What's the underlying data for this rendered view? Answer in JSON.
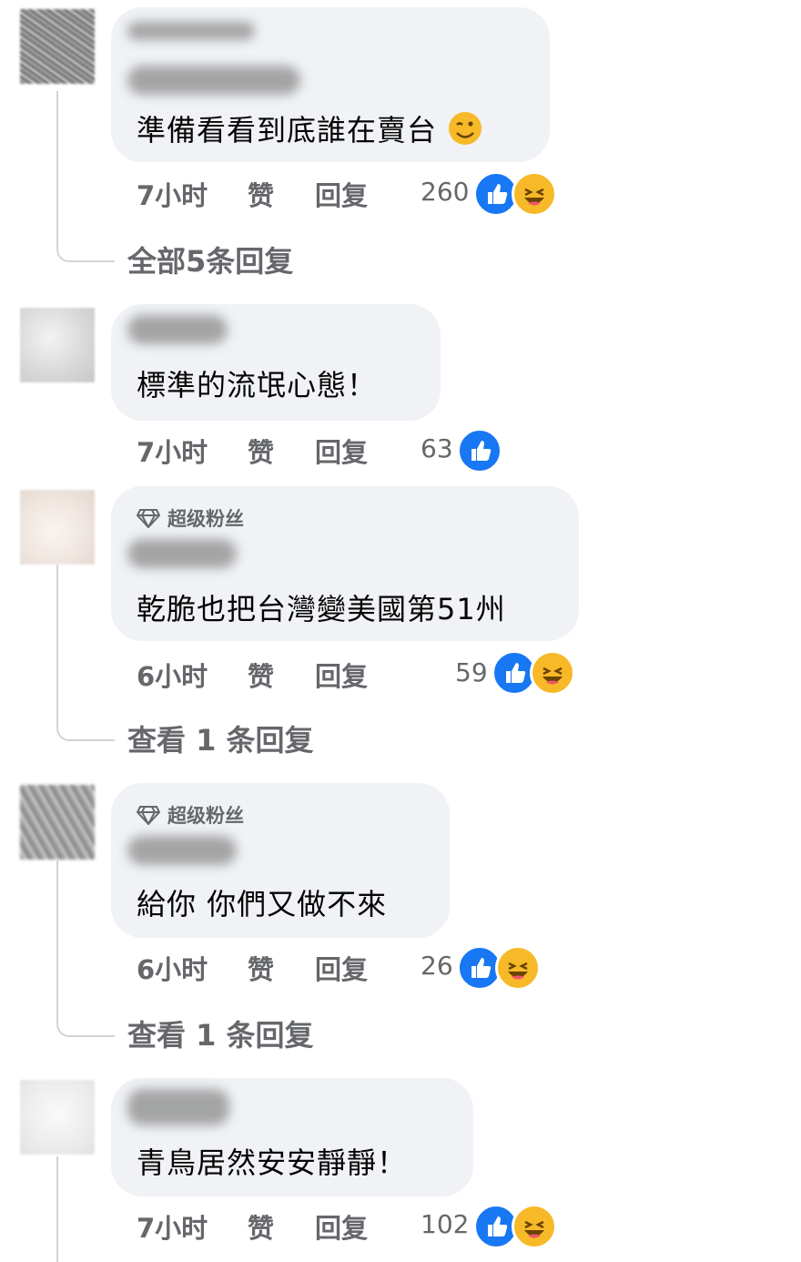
{
  "comments": [
    {
      "badge": "",
      "text": "準備看看到底誰在賣台",
      "emoji": "wink-face",
      "time": "7小时",
      "like_label": "赞",
      "reply_label": "回复",
      "count": "260",
      "reactions": [
        "like",
        "haha"
      ],
      "more_replies": "全部5条回复"
    },
    {
      "badge": "",
      "text": "標準的流氓心態！",
      "time": "7小时",
      "like_label": "赞",
      "reply_label": "回复",
      "count": "63",
      "reactions": [
        "like"
      ]
    },
    {
      "badge": "超级粉丝",
      "text": "乾脆也把台灣變美國第51州",
      "time": "6小时",
      "like_label": "赞",
      "reply_label": "回复",
      "count": "59",
      "reactions": [
        "like",
        "haha"
      ],
      "more_replies": "查看 1 条回复"
    },
    {
      "badge": "超级粉丝",
      "text": "給你 你們又做不來",
      "time": "6小时",
      "like_label": "赞",
      "reply_label": "回复",
      "count": "26",
      "reactions": [
        "like",
        "haha"
      ],
      "more_replies": "查看 1 条回复"
    },
    {
      "badge": "",
      "text": "青鳥居然安安靜靜！",
      "time": "7小时",
      "like_label": "赞",
      "reply_label": "回复",
      "count": "102",
      "reactions": [
        "like",
        "haha"
      ]
    }
  ],
  "colors": {
    "bubble": "#f0f2f5",
    "meta_text": "#65676b",
    "like": "#1877f2",
    "haha": "#f7b928"
  }
}
